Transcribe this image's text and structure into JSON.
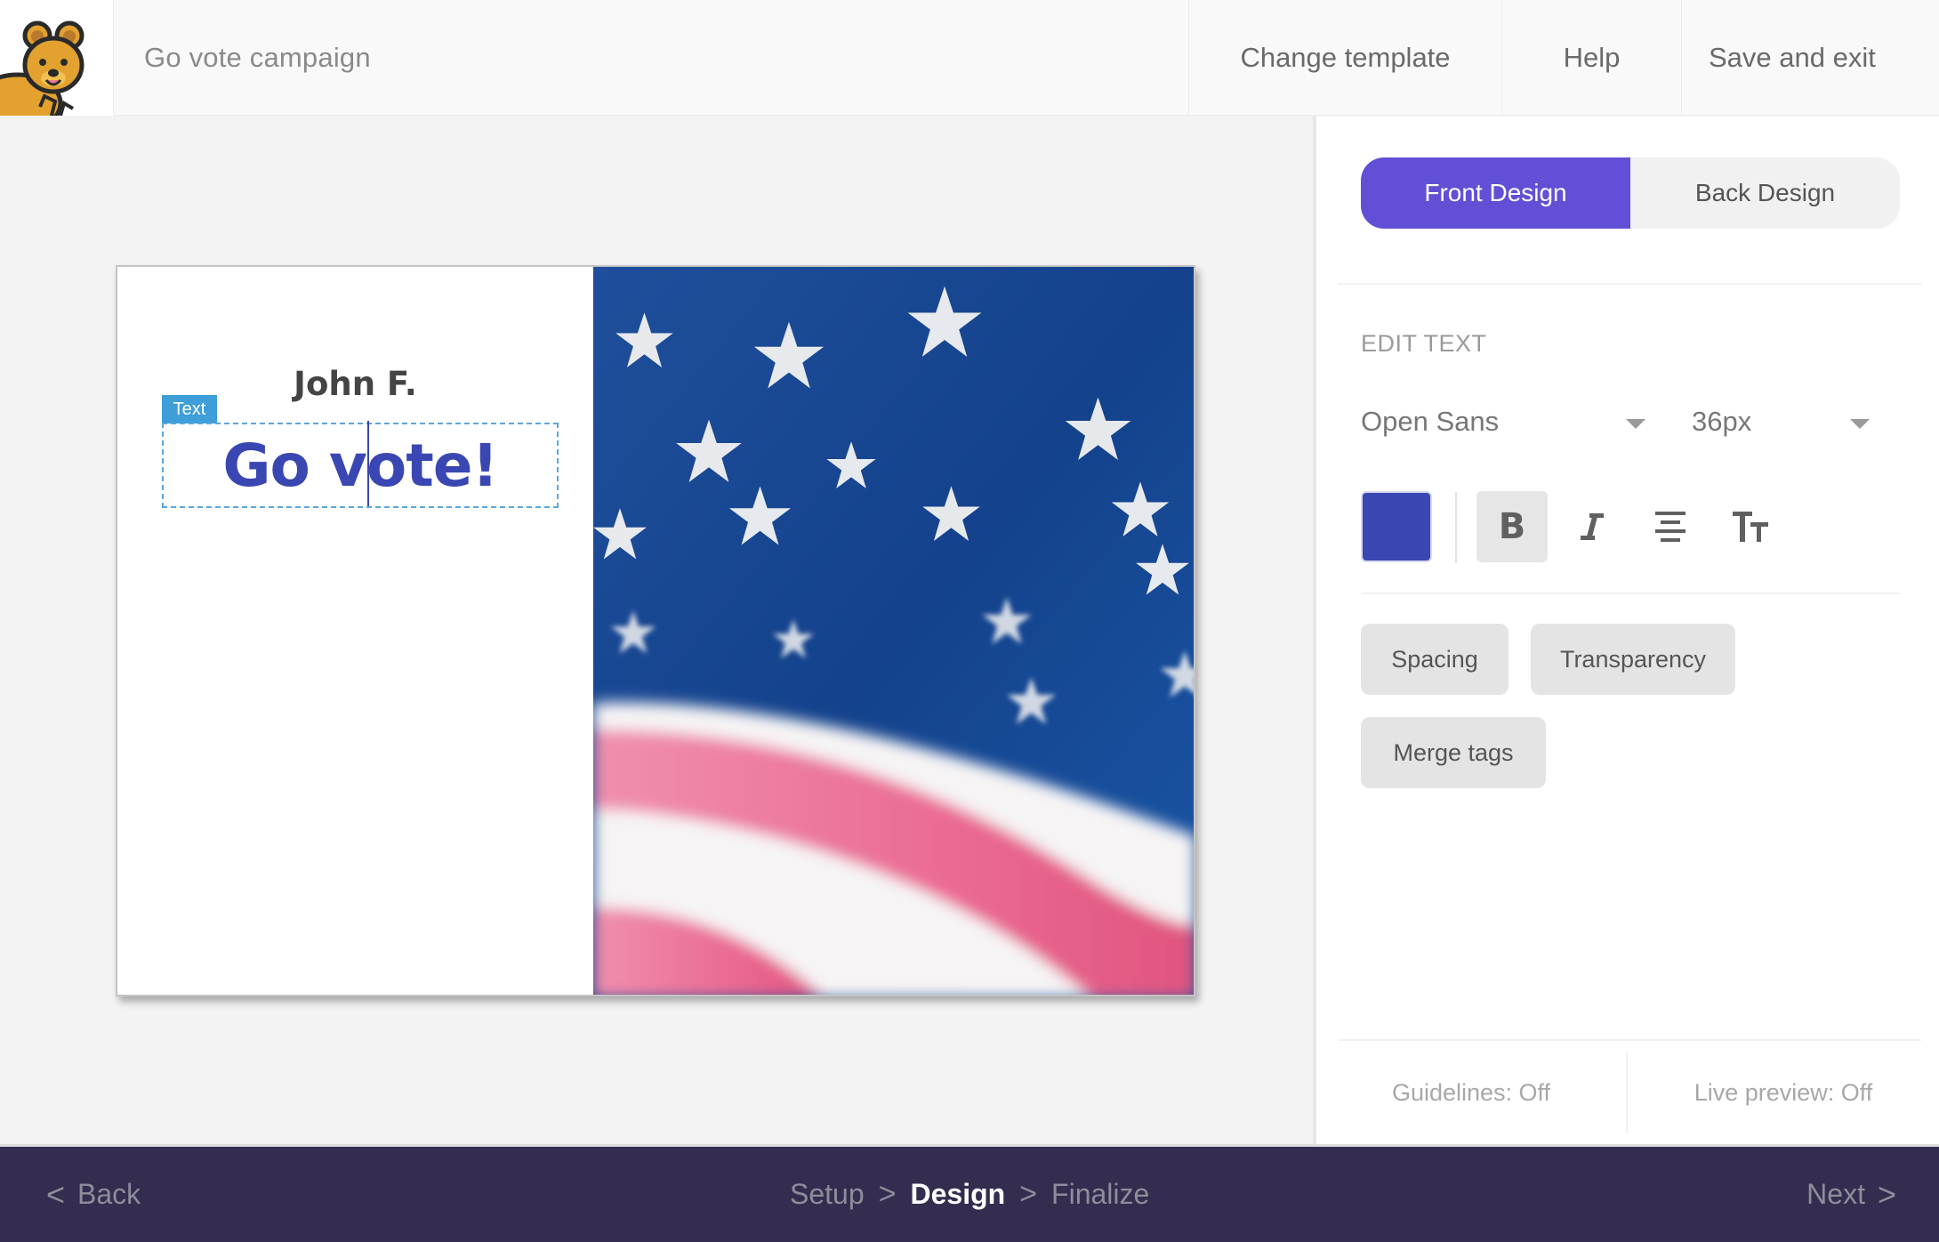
{
  "header": {
    "logo_icon": "quokka-mascot-icon",
    "title": "Go vote campaign",
    "actions": {
      "change_template": "Change template",
      "help": "Help",
      "save_and_exit": "Save and exit"
    }
  },
  "canvas": {
    "card": {
      "name_text": "John F.",
      "selection_tag": "Text",
      "selected_text": "Go vote!",
      "photo": "american-flag-photo",
      "text_color": "#3a47b3",
      "name_color": "#444444"
    }
  },
  "panel": {
    "tabs": [
      {
        "label": "Front Design",
        "active": true
      },
      {
        "label": "Back Design",
        "active": false
      }
    ],
    "section_label": "EDIT TEXT",
    "font_select": {
      "value": "Open Sans"
    },
    "size_select": {
      "value": "36px"
    },
    "color_swatch": "#3a47b3",
    "format_tools": {
      "bold": {
        "label": "B",
        "active": true
      },
      "italic": {
        "label": "I",
        "active": false
      },
      "align": {
        "icon": "align-center-icon"
      },
      "text_case": {
        "icon": "text-size-icon"
      }
    },
    "options": {
      "spacing": "Spacing",
      "transparency": "Transparency",
      "merge_tags": "Merge tags"
    },
    "toggles": {
      "guidelines": "Guidelines: Off",
      "live_preview": "Live preview: Off"
    },
    "accent_color": "#6150d6"
  },
  "footer": {
    "back_label": "Back",
    "next_label": "Next",
    "steps": [
      {
        "label": "Setup",
        "active": false
      },
      {
        "label": "Design",
        "active": true
      },
      {
        "label": "Finalize",
        "active": false
      }
    ],
    "background_color": "#342d4f"
  }
}
